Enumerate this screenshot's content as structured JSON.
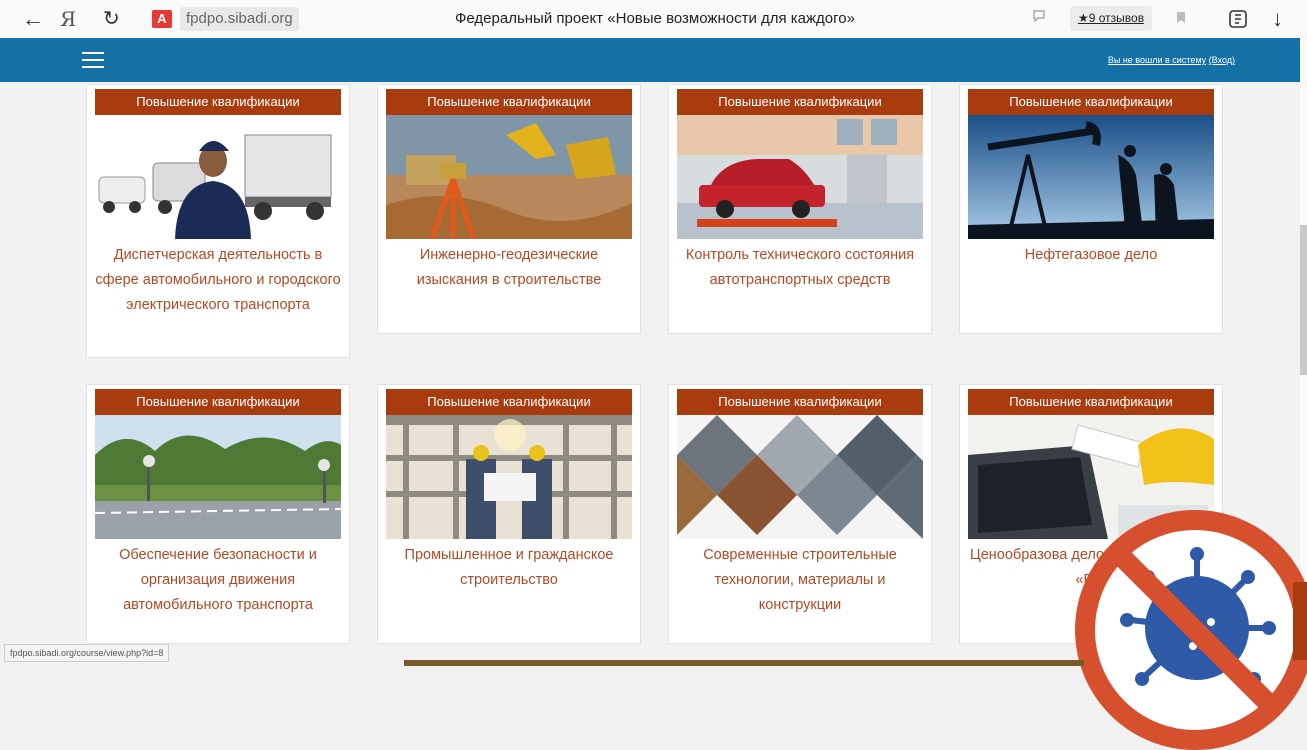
{
  "browser": {
    "back_icon": "←",
    "brand_icon": "Я",
    "reload_icon": "↻",
    "warning_icon": "A",
    "url": "fpdpo.sibadi.org",
    "page_title": "Федеральный проект «Новые возможности для каждого»",
    "reviews": "★9 отзывов",
    "download_icon": "↓"
  },
  "header": {
    "login_text": "Вы не вошли в систему",
    "login_link": "(Вход)"
  },
  "courses": [
    {
      "badge": "Повышение квалификации",
      "title": "Диспетчерская деятельность в сфере автомобильного и городского электрического транспорта"
    },
    {
      "badge": "Повышение квалификации",
      "title": "Инженерно-геодезические изыскания в строительстве"
    },
    {
      "badge": "Повышение квалификации",
      "title": "Контроль технического состояния автотранспортных средств"
    },
    {
      "badge": "Повышение квалификации",
      "title": "Нефтегазовое дело"
    },
    {
      "badge": "Повышение квалификации",
      "title": "Обеспечение безопасности и организация движения автомобильного транспорта"
    },
    {
      "badge": "Повышение квалификации",
      "title": "Промышленное и гражданское строительство"
    },
    {
      "badge": "Повышение квалификации",
      "title": "Современные строительные технологии, материалы и конструкции"
    },
    {
      "badge": "Повышение квалификации",
      "title": "Ценообразова дело с исп программ «Гра"
    }
  ],
  "status_url": "fpdpo.sibadi.org/course/view.php?id=8",
  "colors": {
    "header": "#1570a6",
    "badge": "#a83c0f",
    "title": "#b04a26"
  }
}
